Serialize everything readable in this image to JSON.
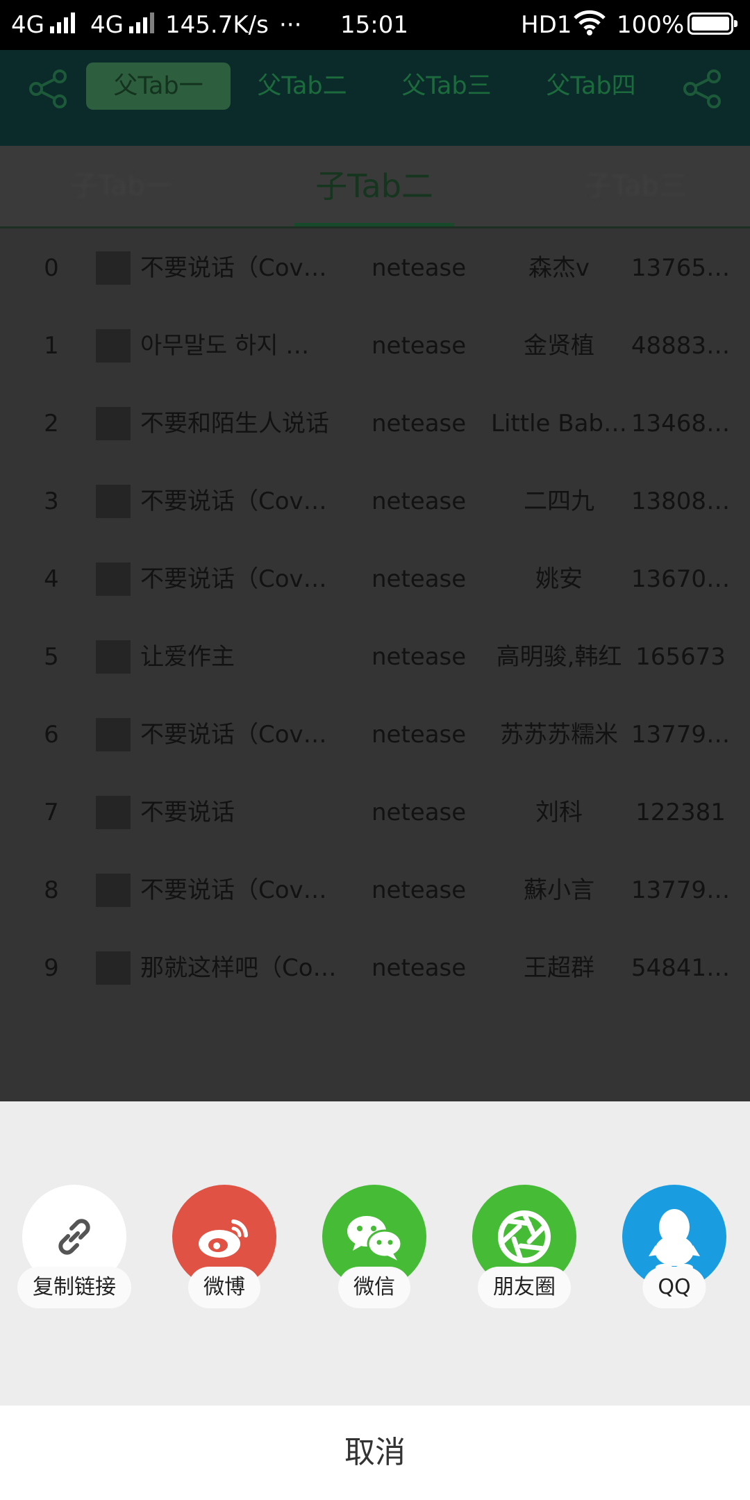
{
  "status_bar": {
    "network_1": "4G",
    "network_2": "4G",
    "speed": "145.7K/s",
    "dots": "···",
    "time": "15:01",
    "hd": "HD1",
    "battery": "100%",
    "battery_level": 1.0
  },
  "header": {
    "share_icon_left": "share-icon",
    "share_icon_right": "share-icon",
    "parent_tabs": [
      {
        "label": "父Tab一",
        "active": true
      },
      {
        "label": "父Tab二",
        "active": false
      },
      {
        "label": "父Tab三",
        "active": false
      },
      {
        "label": "父Tab四",
        "active": false
      }
    ]
  },
  "sub_tabs": [
    {
      "label": "子Tab一",
      "active": false
    },
    {
      "label": "子Tab二",
      "active": true
    },
    {
      "label": "子Tab三",
      "active": false
    }
  ],
  "songs": [
    {
      "index": "0",
      "title": "不要说话（Cov…",
      "source": "netease",
      "artist": "森杰v",
      "id": "13765…"
    },
    {
      "index": "1",
      "title": "아무말도 하지 …",
      "source": "netease",
      "artist": "金贤植",
      "id": "48883…"
    },
    {
      "index": "2",
      "title": "不要和陌生人说话",
      "source": "netease",
      "artist": "Little Bab…",
      "id": "13468…"
    },
    {
      "index": "3",
      "title": "不要说话（Cov…",
      "source": "netease",
      "artist": "二四九",
      "id": "13808…"
    },
    {
      "index": "4",
      "title": "不要说话（Cov…",
      "source": "netease",
      "artist": "姚安",
      "id": "13670…"
    },
    {
      "index": "5",
      "title": "让爱作主",
      "source": "netease",
      "artist": "高明骏,韩红",
      "id": "165673"
    },
    {
      "index": "6",
      "title": "不要说话（Cov…",
      "source": "netease",
      "artist": "苏苏苏糯米",
      "id": "13779…"
    },
    {
      "index": "7",
      "title": "不要说话",
      "source": "netease",
      "artist": "刘科",
      "id": "122381"
    },
    {
      "index": "8",
      "title": "不要说话（Cov…",
      "source": "netease",
      "artist": "蘇小言",
      "id": "13779…"
    },
    {
      "index": "9",
      "title": "那就这样吧（Co…",
      "source": "netease",
      "artist": "王超群",
      "id": "54841…"
    }
  ],
  "share_sheet": {
    "options": [
      {
        "label": "复制链接",
        "icon": "link-icon",
        "color": "#ffffff"
      },
      {
        "label": "微博",
        "icon": "weibo-icon",
        "color": "#e05244"
      },
      {
        "label": "微信",
        "icon": "wechat-icon",
        "color": "#46bb36"
      },
      {
        "label": "朋友圈",
        "icon": "moments-icon",
        "color": "#46bb36"
      },
      {
        "label": "QQ",
        "icon": "qq-icon",
        "color": "#1a9de0"
      }
    ],
    "cancel_label": "取消"
  }
}
